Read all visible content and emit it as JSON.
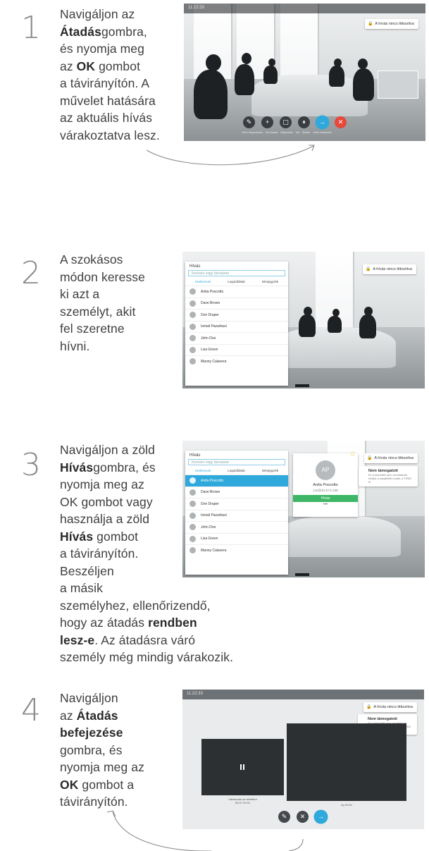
{
  "steps": [
    {
      "number": "1",
      "lines": [
        [
          {
            "t": "Navigáljon az"
          }
        ],
        [
          {
            "t": "Átadás",
            "b": true
          },
          {
            "t": "gombra,"
          }
        ],
        [
          {
            "t": "és nyomja meg"
          }
        ],
        [
          {
            "t": "az "
          },
          {
            "t": "OK",
            "b": true
          },
          {
            "t": " gombot"
          }
        ],
        [
          {
            "t": "a távirányítón. A"
          }
        ],
        [
          {
            "t": "művelet hatására"
          }
        ],
        [
          {
            "t": "az aktuális hívás"
          }
        ],
        [
          {
            "t": "várakoztatva lesz."
          }
        ]
      ],
      "screen": {
        "clock": "11:22:33",
        "badge": "A hívás nincs titkosítva",
        "controls": [
          "✎",
          "+",
          "▢",
          "⏸",
          "→",
          "✕"
        ],
        "control_labels": [
          "Videó kikapcsolása",
          "Hozzáadás",
          "Megosztás",
          "Tart",
          "Átadás",
          "Hívás befejezése"
        ]
      }
    },
    {
      "number": "2",
      "lines": [
        [
          {
            "t": "A szokásos"
          }
        ],
        [
          {
            "t": "módon keresse"
          }
        ],
        [
          {
            "t": "ki azt a"
          }
        ],
        [
          {
            "t": "személyt, akit"
          }
        ],
        [
          {
            "t": "fel szeretne"
          }
        ],
        [
          {
            "t": "hívni."
          }
        ]
      ],
      "screen": {
        "panel_title": "Hívás",
        "search_placeholder": "Keresés vagy tárcsázás",
        "tabs": [
          "Kedvencek",
          "Legutóbbiak",
          "Névjegyzék"
        ],
        "contacts": [
          "Anita Poscotto",
          "Dave Brown",
          "Don Draper",
          "Ismail Pazarbasi",
          "John Doe",
          "Lisa Green",
          "Manny Calavera"
        ],
        "badge": "A hívás nincs titkosítva"
      }
    },
    {
      "number": "3",
      "lines": [
        [
          {
            "t": "Navigáljon a zöld"
          }
        ],
        [
          {
            "t": "Hívás",
            "b": true
          },
          {
            "t": "gombra, és"
          }
        ],
        [
          {
            "t": "nyomja meg az"
          }
        ],
        [
          {
            "t": "OK gombot vagy"
          }
        ],
        [
          {
            "t": "használja a zöld"
          }
        ],
        [
          {
            "t": "Hívás",
            "b": true
          },
          {
            "t": " gombot"
          }
        ],
        [
          {
            "t": "a távirányítón."
          }
        ],
        [
          {
            "t": "Beszéljen"
          }
        ],
        [
          {
            "t": "a másik"
          }
        ],
        [
          {
            "t": "személyhez, ellenőrizendő,"
          }
        ],
        [
          {
            "t": "hogy az átadás "
          },
          {
            "t": "rendben",
            "b": true
          }
        ],
        [
          {
            "t": "lesz-e",
            "b": true
          },
          {
            "t": ". Az átadásra váró"
          }
        ],
        [
          {
            "t": "személy még mindig várakozik."
          }
        ]
      ],
      "screen": {
        "panel_title": "Hívás",
        "search_placeholder": "Keresés vagy tárcsázás",
        "tabs": [
          "Kedvencek",
          "Legutóbbiak",
          "Névjegyzék"
        ],
        "contacts": [
          "Anita Poscotto",
          "Dave Brown",
          "Don Draper",
          "Ismail Pazarbasi",
          "John Doe",
          "Lisa Green",
          "Manny Calavera"
        ],
        "card_initials": "AP",
        "card_name": "Anita Poscotto",
        "card_address": "1xx@10.47.6.108",
        "card_call": "Hívás",
        "badge": "A hívás nincs titkosítva",
        "badge2_title": "Nem támogatott",
        "badge2_sub": "Ez a készülék nem rendelkezik. Kérjük a megfelelő mobilt, a TRS3 ül."
      }
    },
    {
      "number": "4",
      "lines": [
        [
          {
            "t": "Navigáljon"
          }
        ],
        [
          {
            "t": "az "
          },
          {
            "t": "Átadás",
            "b": true
          }
        ],
        [
          {
            "t": "befejezése",
            "b": true
          }
        ],
        [
          {
            "t": "gombra, és"
          }
        ],
        [
          {
            "t": "nyomja meg az"
          }
        ],
        [
          {
            "t": "OK",
            "b": true
          },
          {
            "t": " gombot a"
          }
        ],
        [
          {
            "t": "távirányítón."
          }
        ]
      ],
      "screen": {
        "clock": "11:22:33",
        "badge": "A hívás nincs titkosítva",
        "badge2_title": "Nem támogatott",
        "badge2_sub": "Ez a készülék nem rendelkezik. Kérjük a megfelelő mobilt, a TRS3 ül.",
        "tile1_caption": "Várakozás az átvételre",
        "tile1_time": "00:07  00:01",
        "tile2_caption": "Ivy  00:01",
        "controls": [
          "✎",
          "✕",
          "→"
        ],
        "control_labels": [
          "Videó kikapcsolása",
          "Mégse",
          "Átadás befejezése"
        ]
      }
    }
  ],
  "colors": {
    "accent": "#2fa9dc",
    "end_call": "#e8473b",
    "call_green": "#3db665",
    "star": "#f3c327"
  }
}
